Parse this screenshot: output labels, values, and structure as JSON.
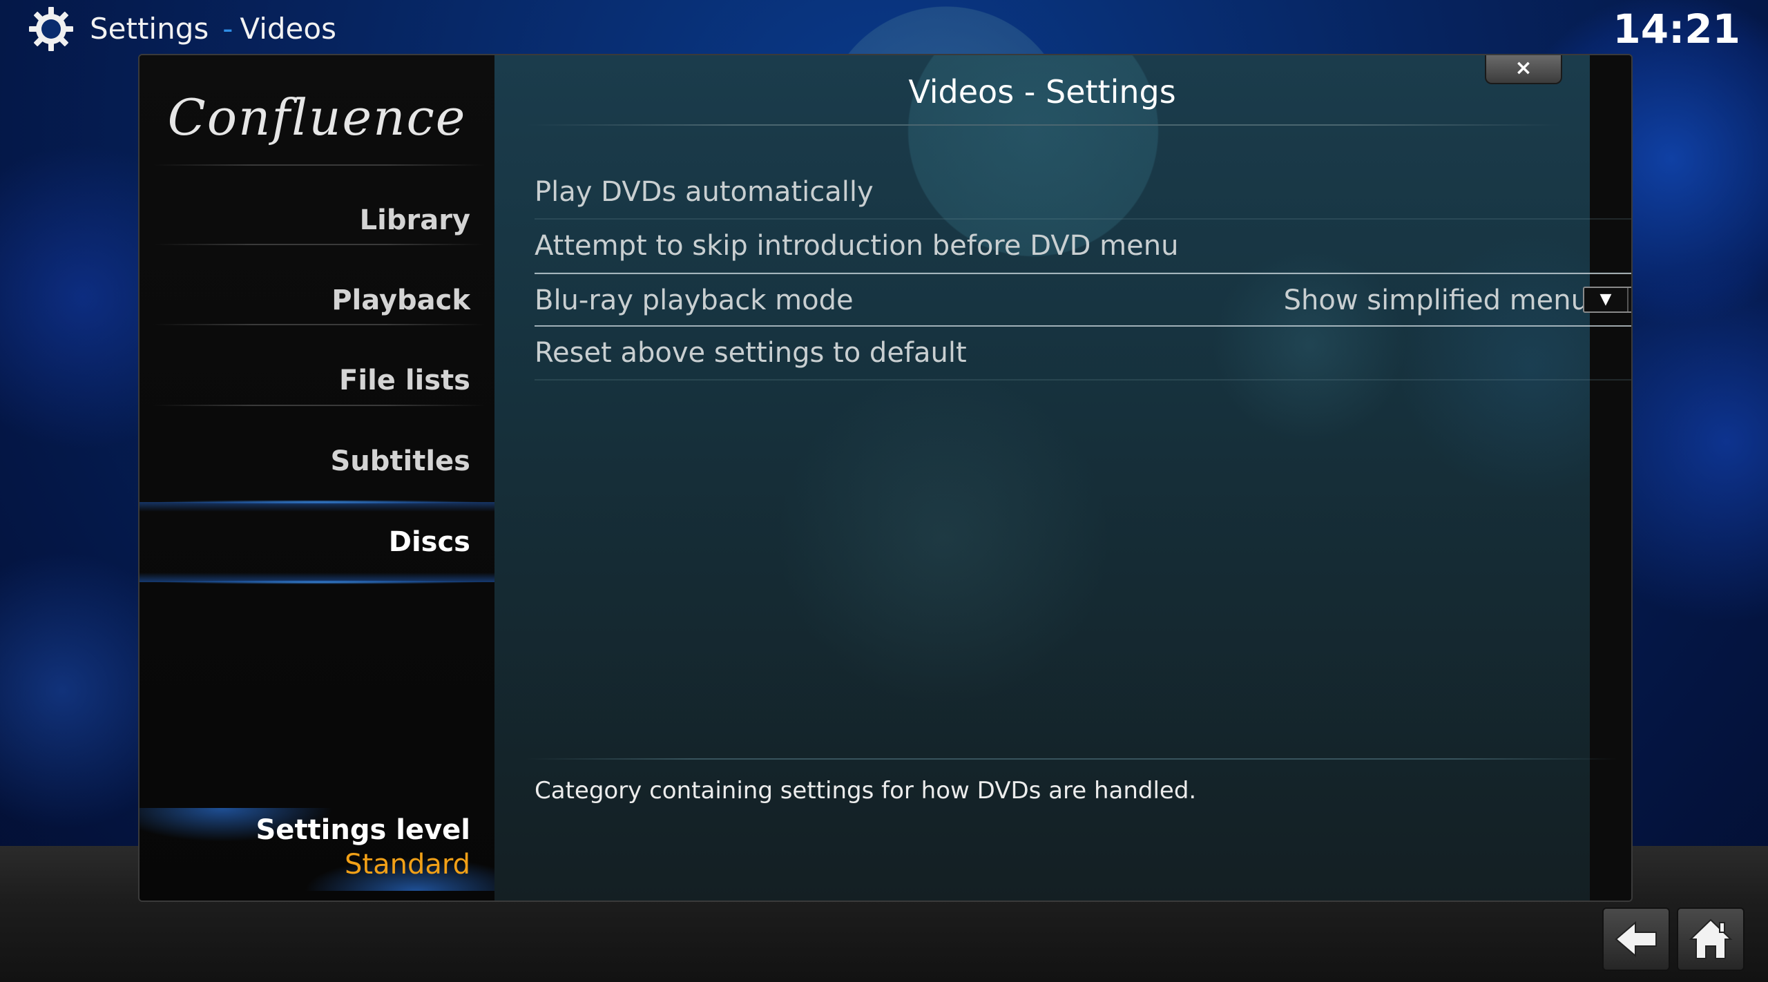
{
  "header": {
    "section": "Settings",
    "separator": "-",
    "subsection": "Videos",
    "clock": "14:21",
    "icon": "gear-icon"
  },
  "dialog": {
    "title": "Videos - Settings",
    "close_label": "×",
    "logo_text": "Confluence"
  },
  "sidebar": {
    "items": [
      {
        "label": "Library"
      },
      {
        "label": "Playback"
      },
      {
        "label": "File lists"
      },
      {
        "label": "Subtitles"
      },
      {
        "label": "Discs",
        "active": true
      }
    ],
    "settings_level_label": "Settings level",
    "settings_level_value": "Standard"
  },
  "settings": {
    "rows": [
      {
        "label": "Play DVDs automatically",
        "type": "toggle",
        "value": false
      },
      {
        "label": "Attempt to skip introduction before DVD menu",
        "type": "toggle",
        "value": false
      },
      {
        "label": "Blu-ray playback mode",
        "type": "spinner",
        "value": "Show simplified menu",
        "focused": true
      },
      {
        "label": "Reset above settings to default",
        "type": "action"
      }
    ],
    "spinner_down_glyph": "▼",
    "spinner_up_glyph": "▲"
  },
  "description": "Category containing settings for how DVDs are handled.",
  "nav": {
    "back_icon": "back-arrow-icon",
    "home_icon": "home-icon"
  },
  "colors": {
    "accent_blue": "#2f8ee6",
    "level_value": "#f1a017"
  }
}
